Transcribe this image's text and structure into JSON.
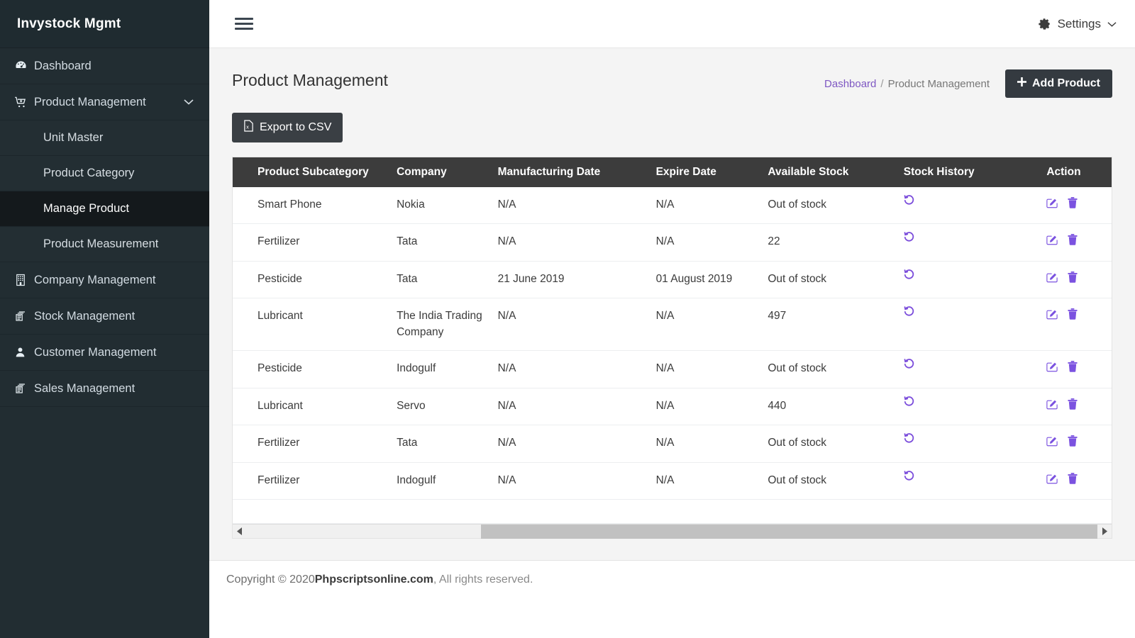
{
  "sidebar": {
    "brand": "Invystock Mgmt",
    "items": [
      {
        "label": "Dashboard",
        "icon": "dashboard-icon"
      },
      {
        "label": "Product Management",
        "icon": "cart-icon",
        "expanded": true,
        "caret": "chevron-down-icon"
      },
      {
        "label": "Company Management",
        "icon": "building-icon"
      },
      {
        "label": "Stock Management",
        "icon": "layers-icon"
      },
      {
        "label": "Customer Management",
        "icon": "user-icon"
      },
      {
        "label": "Sales Management",
        "icon": "layers-icon"
      }
    ],
    "submenu": [
      {
        "label": "Unit Master",
        "active": false
      },
      {
        "label": "Product Category",
        "active": false
      },
      {
        "label": "Manage Product",
        "active": true
      },
      {
        "label": "Product Measurement",
        "active": false
      }
    ]
  },
  "topbar": {
    "menu_toggle": "hamburger-icon",
    "settings_label": "Settings",
    "settings_icon": "gear-icon",
    "settings_caret": "chevron-down-icon"
  },
  "page": {
    "title": "Product Management",
    "breadcrumb_home": "Dashboard",
    "breadcrumb_sep": "/",
    "breadcrumb_current": "Product Management",
    "add_button": "Add Product",
    "add_button_icon": "plus-icon",
    "export_button": "Export to CSV",
    "export_button_icon": "file-excel-icon"
  },
  "table": {
    "columns": [
      "Product Subcategory",
      "Company",
      "Manufacturing Date",
      "Expire Date",
      "Available Stock",
      "Stock History",
      "Action"
    ],
    "rows": [
      {
        "subcategory": "Smart Phone",
        "company": "Nokia",
        "manufacturing_date": "N/A",
        "expire_date": "N/A",
        "available_stock": "Out of stock",
        "out_of_stock": true
      },
      {
        "subcategory": "Fertilizer",
        "company": "Tata",
        "manufacturing_date": "N/A",
        "expire_date": "N/A",
        "available_stock": "22",
        "out_of_stock": false
      },
      {
        "subcategory": "Pesticide",
        "company": "Tata",
        "manufacturing_date": "21 June 2019",
        "expire_date": "01 August 2019",
        "available_stock": "Out of stock",
        "out_of_stock": true
      },
      {
        "subcategory": "Lubricant",
        "company": "The India Trading Company",
        "manufacturing_date": "N/A",
        "expire_date": "N/A",
        "available_stock": "497",
        "out_of_stock": false
      },
      {
        "subcategory": "Pesticide",
        "company": "Indogulf",
        "manufacturing_date": "N/A",
        "expire_date": "N/A",
        "available_stock": "Out of stock",
        "out_of_stock": true
      },
      {
        "subcategory": "Lubricant",
        "company": "Servo",
        "manufacturing_date": "N/A",
        "expire_date": "N/A",
        "available_stock": "440",
        "out_of_stock": false
      },
      {
        "subcategory": "Fertilizer",
        "company": "Tata",
        "manufacturing_date": "N/A",
        "expire_date": "N/A",
        "available_stock": "Out of stock",
        "out_of_stock": true
      },
      {
        "subcategory": "Fertilizer",
        "company": "Indogulf",
        "manufacturing_date": "N/A",
        "expire_date": "N/A",
        "available_stock": "Out of stock",
        "out_of_stock": true
      }
    ],
    "row_icons": {
      "history": "history-icon",
      "edit": "edit-icon",
      "delete": "trash-icon"
    },
    "scrollbar": {
      "left_arrow": "caret-left-icon",
      "right_arrow": "caret-right-icon"
    }
  },
  "footer": {
    "prefix": "Copyright © 2020 ",
    "brand": "Phpscriptsonline.com",
    "suffix": " , All rights reserved."
  },
  "colors": {
    "sidebar_bg": "#222d32",
    "sidebar_active": "#14191c",
    "content_bg": "#f4f4f4",
    "table_header_bg": "#3c3c3c",
    "accent_purple": "#7b52e0",
    "link_purple": "#7e57c2",
    "danger_red": "#ff0000",
    "button_dark": "#343a40"
  }
}
